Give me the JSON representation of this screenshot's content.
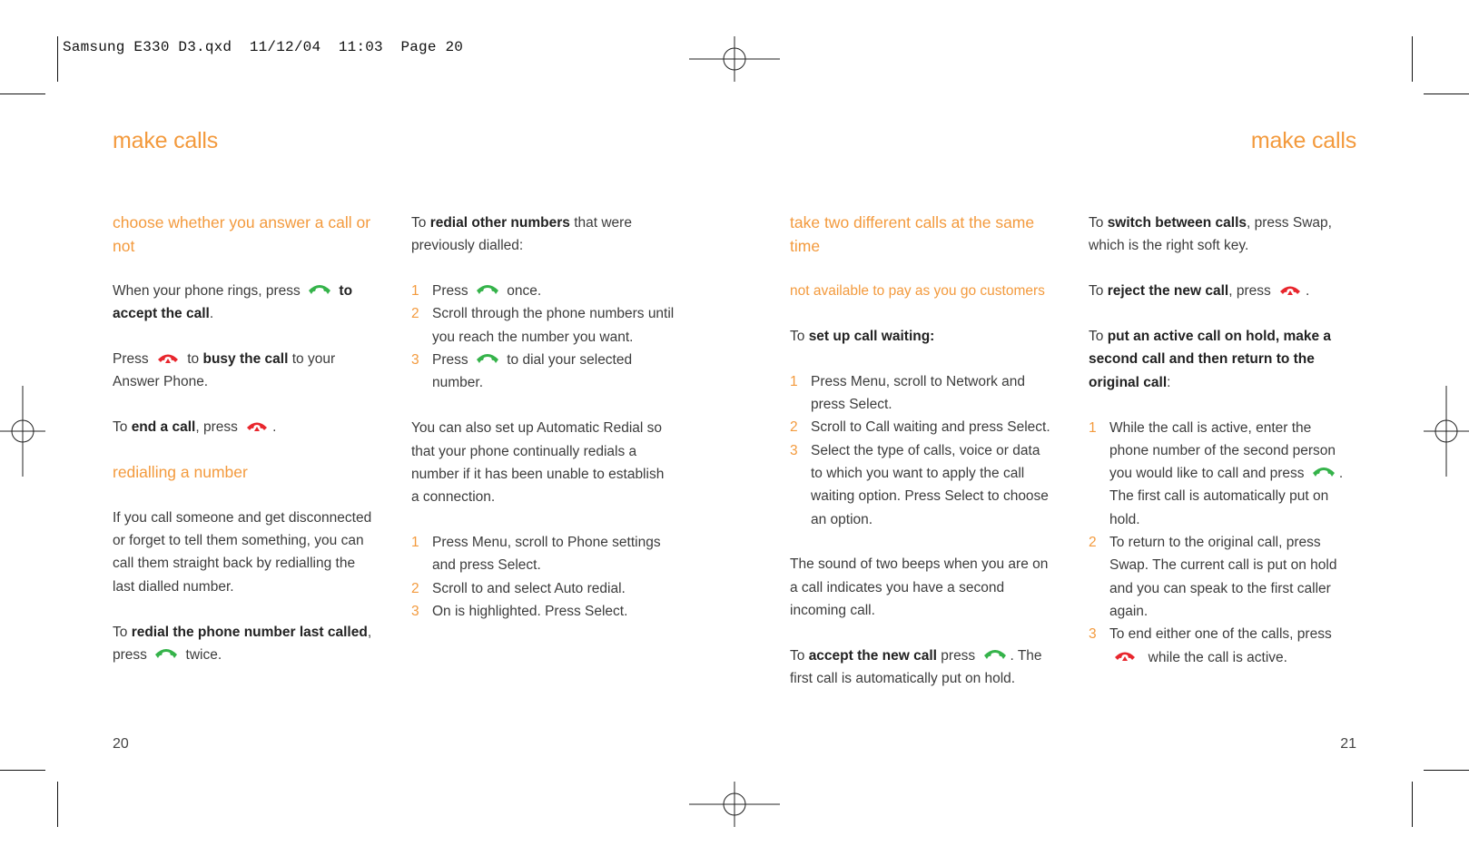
{
  "slug": "Samsung E330 D3.qxd  11/12/04  11:03  Page 20",
  "colors": {
    "accent": "#f39a3d",
    "call_icon": "#35b34a",
    "end_icon": "#e8262d"
  },
  "icons": {
    "call": "green-phone-handset-icon",
    "end": "red-hangup-handset-icon"
  },
  "left_page": {
    "title": "make calls",
    "page_number": "20",
    "col1": {
      "heading1": "choose whether you answer a call or not",
      "p1": {
        "t1": "When your phone rings, press",
        "b1": "to accept the call",
        "t2": "."
      },
      "p2": {
        "t1": "Press",
        "t2": "to",
        "b1": "busy the call",
        "t3": "to your Answer Phone."
      },
      "p3": {
        "t1": "To",
        "b1": "end a call",
        "t2": ", press",
        "t3": "."
      },
      "heading2": "redialling a number",
      "p4": "If you call someone and get disconnected or forget to tell them something, you can call them straight back by redialling the last dialled number.",
      "p5": {
        "t1": "To",
        "b1": "redial the phone number last called",
        "t2": ",",
        "t3": "press",
        "t4": "twice."
      }
    },
    "col2": {
      "p1": {
        "t1": "To",
        "b1": "redial other numbers",
        "t2": "that were previously dialled:"
      },
      "list1": [
        {
          "num": "1",
          "t1": "Press",
          "t2": "once."
        },
        {
          "num": "2",
          "text": "Scroll through the phone numbers until you reach the number you want."
        },
        {
          "num": "3",
          "t1": "Press",
          "t2": "to dial your selected number."
        }
      ],
      "p2": "You can also set up Automatic Redial so that your phone continually redials a number if it has been unable to establish a connection.",
      "list2": [
        {
          "num": "1",
          "text": "Press Menu, scroll to Phone settings and press Select."
        },
        {
          "num": "2",
          "text": "Scroll to and select Auto redial."
        },
        {
          "num": "3",
          "text": "On is highlighted. Press Select."
        }
      ]
    }
  },
  "right_page": {
    "title": "make calls",
    "page_number": "21",
    "col3": {
      "heading": "take two different calls at the same time",
      "note": "not available to pay as you go customers",
      "p1": {
        "t1": "To",
        "b1": "set up call waiting:"
      },
      "list": [
        {
          "num": "1",
          "text": "Press Menu, scroll to Network and press Select."
        },
        {
          "num": "2",
          "text": "Scroll to Call waiting and press Select."
        },
        {
          "num": "3",
          "text": "Select the type of calls, voice or data to which you want to apply the call waiting option. Press Select to choose an option."
        }
      ],
      "p2": "The sound of two beeps when you are on a call indicates you have a second incoming call.",
      "p3": {
        "t1": "To",
        "b1": "accept the new call",
        "t2": "press",
        "t3": ". The first call is automatically put on hold."
      }
    },
    "col4": {
      "p1": {
        "t1": "To",
        "b1": "switch between calls",
        "t2": ", press Swap, which is the right soft key."
      },
      "p2": {
        "t1": "To",
        "b1": "reject the new call",
        "t2": ", press",
        "t3": "."
      },
      "p3": {
        "t1": "To",
        "b1": "put an active call on hold, make a second call and then return to the original call",
        "t2": ":"
      },
      "list": [
        {
          "num": "1",
          "t1": "While the call is active, enter the phone number of the second person you would like to call and press",
          "t2": ". The first call is automatically put on hold."
        },
        {
          "num": "2",
          "text": "To return to the original call, press Swap. The current call is put on hold and you can speak to the first caller again."
        },
        {
          "num": "3",
          "t1": "To end either one of the calls, press",
          "t2": "while the call is active."
        }
      ]
    }
  }
}
